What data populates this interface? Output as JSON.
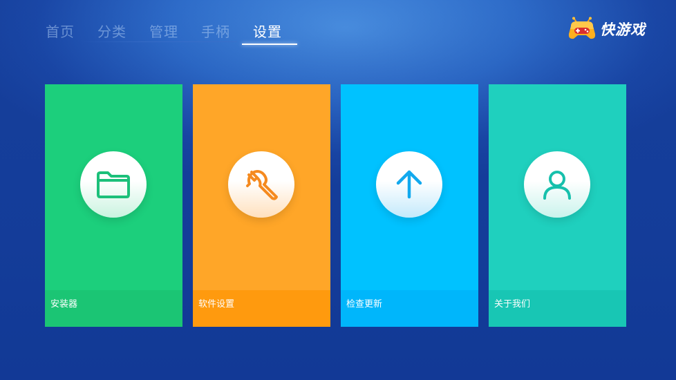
{
  "nav": {
    "items": [
      {
        "label": "首页"
      },
      {
        "label": "分类"
      },
      {
        "label": "管理"
      },
      {
        "label": "手柄"
      },
      {
        "label": "设置"
      }
    ],
    "active_index": 4
  },
  "logo": {
    "text": "快游戏",
    "icon": "gamepad-mascot-icon"
  },
  "tiles": [
    {
      "label": "安装器",
      "icon": "folder-icon",
      "color": "#1ccf7c"
    },
    {
      "label": "软件设置",
      "icon": "wrench-icon",
      "color": "#ffa628"
    },
    {
      "label": "检查更新",
      "icon": "arrow-up-icon",
      "color": "#00c2ff"
    },
    {
      "label": "关于我们",
      "icon": "user-icon",
      "color": "#1fd0be"
    }
  ]
}
